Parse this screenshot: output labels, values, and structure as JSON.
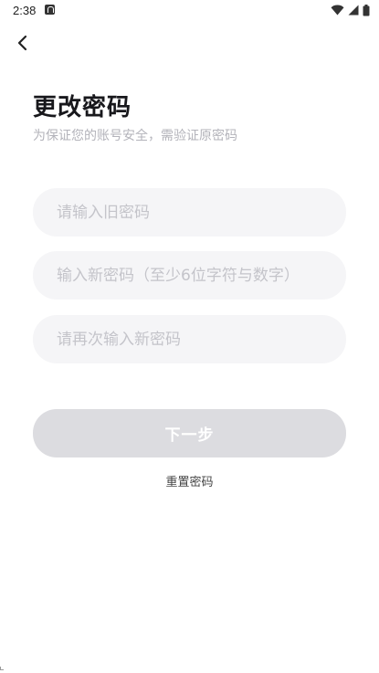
{
  "status_bar": {
    "time": "2:38",
    "icons": [
      "notification-a-icon",
      "wifi-icon",
      "signal-icon",
      "battery-icon"
    ]
  },
  "nav": {
    "back_icon": "chevron-left-icon"
  },
  "header": {
    "title": "更改密码",
    "subtitle": "为保证您的账号安全，需验证原密码"
  },
  "form": {
    "old_password_placeholder": "请输入旧密码",
    "new_password_placeholder": "输入新密码（至少6位字符与数字）",
    "confirm_password_placeholder": "请再次输入新密码",
    "next_label": "下一步",
    "reset_label": "重置密码"
  },
  "colors": {
    "field_bg": "#f5f5f7",
    "button_disabled_bg": "#dcdce0",
    "placeholder": "#c4c4ca",
    "subtitle": "#b3b3ba"
  }
}
